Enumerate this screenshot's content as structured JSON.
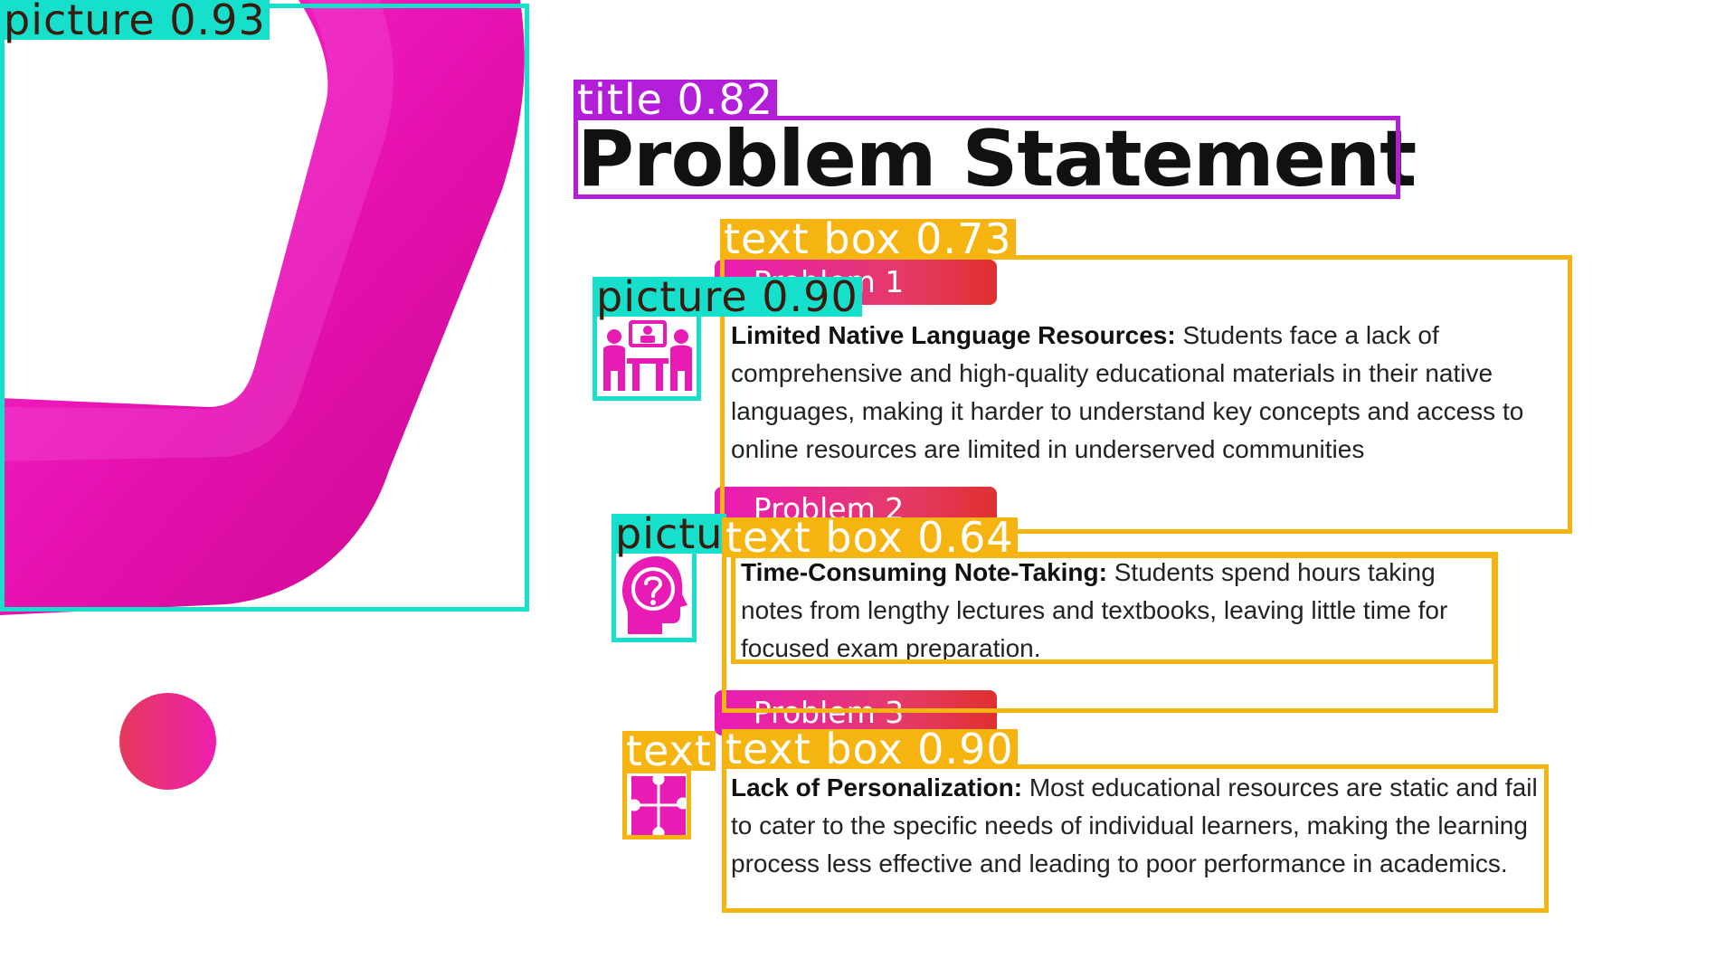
{
  "slide": {
    "title": "Problem Statement",
    "problems": [
      {
        "tag": "Problem 1",
        "heading": "Limited Native Language Resources:",
        "body": " Students face a lack of comprehensive and high-quality educational materials in their native languages, making it harder to understand key concepts and access to online resources are limited in underserved communities",
        "icon": "classroom-meeting-icon"
      },
      {
        "tag": "Problem 2",
        "heading": "Time-Consuming Note-Taking:",
        "body": " Students spend hours taking notes from lengthy lectures and textbooks, leaving little time for focused exam preparation.",
        "icon": "head-question-icon"
      },
      {
        "tag": "Problem 3",
        "heading": "Lack of Personalization:",
        "body": " Most educational resources are static and fail to cater to the specific needs of individual learners, making the learning process less effective and leading to poor performance in academics.",
        "icon": "puzzle-piece-icon"
      }
    ]
  },
  "detections": {
    "picture_main": "picture 0.93",
    "title": "title 0.82",
    "text_box_1": "text box 0.73",
    "picture_1": "picture 0.90",
    "picture_2": "pictu",
    "text_box_2": "text box 0.64",
    "text_3": "text",
    "text_box_3": "text box 0.90"
  },
  "colors": {
    "accent_magenta": "#e91bb8",
    "accent_red": "#e03030",
    "detect_picture": "#16e0cc",
    "detect_title": "#b31fd8",
    "detect_text": "#f5b40f"
  }
}
